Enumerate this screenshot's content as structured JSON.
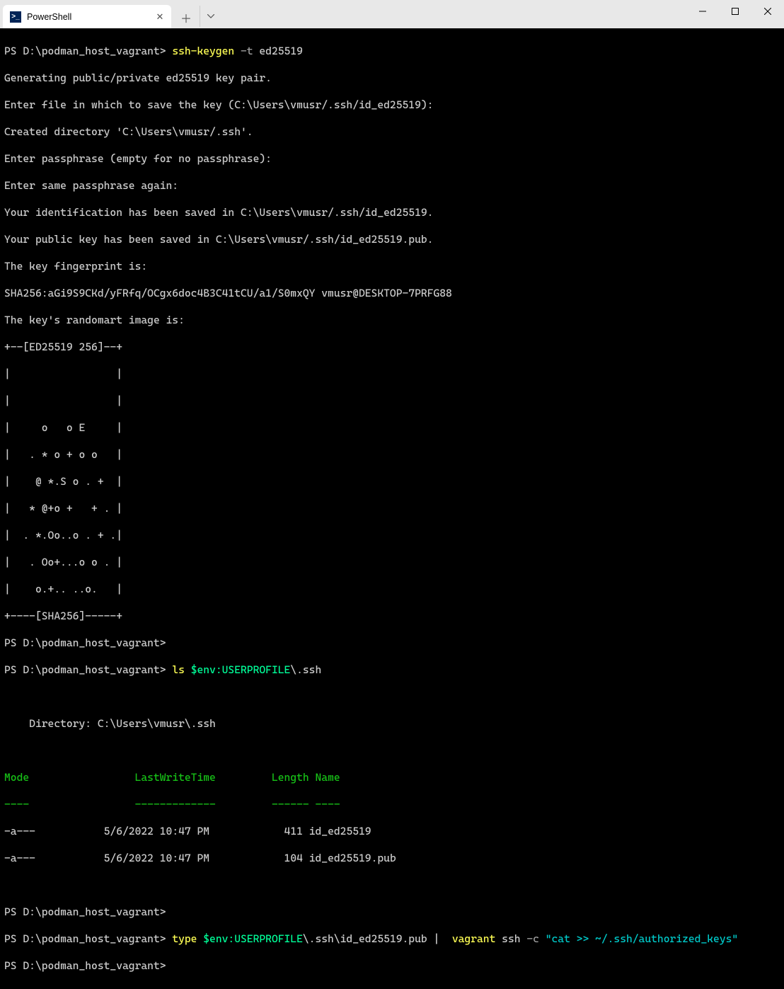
{
  "titlebar": {
    "tab_title": "PowerShell",
    "tab_icon_glyph": ">_"
  },
  "terminal": {
    "prompt": "PS D:\\podman_host_vagrant>",
    "cmd1": {
      "cmd": "ssh-keygen",
      "flag": "-t",
      "arg": "ed25519"
    },
    "out1": [
      "Generating public/private ed25519 key pair.",
      "Enter file in which to save the key (C:\\Users\\vmusr/.ssh/id_ed25519):",
      "Created directory 'C:\\Users\\vmusr/.ssh'.",
      "Enter passphrase (empty for no passphrase):",
      "Enter same passphrase again:",
      "Your identification has been saved in C:\\Users\\vmusr/.ssh/id_ed25519.",
      "Your public key has been saved in C:\\Users\\vmusr/.ssh/id_ed25519.pub.",
      "The key fingerprint is:",
      "SHA256:aGi9S9CKd/yFRfq/OCgx6doc4B3C41tCU/a1/S0mxQY vmusr@DESKTOP-7PRFG88",
      "The key's randomart image is:",
      "+--[ED25519 256]--+",
      "|                 |",
      "|                 |",
      "|     o   o E     |",
      "|   . * o + o o   |",
      "|    @ *.S o . +  |",
      "|   * @+o +   + . |",
      "|  . *.Oo..o . + .|",
      "|   . Oo+...o o . |",
      "|    o.+.. ..o.   |",
      "+----[SHA256]-----+"
    ],
    "cmd2": {
      "cmd": "ls",
      "var": "$env:USERPROFILE",
      "suffix": "\\.ssh"
    },
    "dir_header": "    Directory: C:\\Users\\vmusr\\.ssh",
    "table_headers": {
      "mode": "Mode",
      "lwt": "LastWriteTime",
      "length": "Length",
      "name": "Name"
    },
    "table_sep": {
      "mode": "----",
      "lwt": "-------------",
      "length": "------",
      "name": "----"
    },
    "rows": [
      {
        "mode": "-a---",
        "date": "5/6/2022 10:47 PM",
        "len": "411",
        "name": "id_ed25519"
      },
      {
        "mode": "-a---",
        "date": "5/6/2022 10:47 PM",
        "len": "104",
        "name": "id_ed25519.pub"
      }
    ],
    "cmd3": {
      "cmd": "type",
      "var": "$env:USERPROFILE",
      "suffix": "\\.ssh\\id_ed25519.pub",
      "pipe": "|",
      "cmd2": "vagrant",
      "sub": "ssh",
      "flag": "-c",
      "str": "\"cat >> ~/.ssh/authorized_keys\""
    }
  }
}
